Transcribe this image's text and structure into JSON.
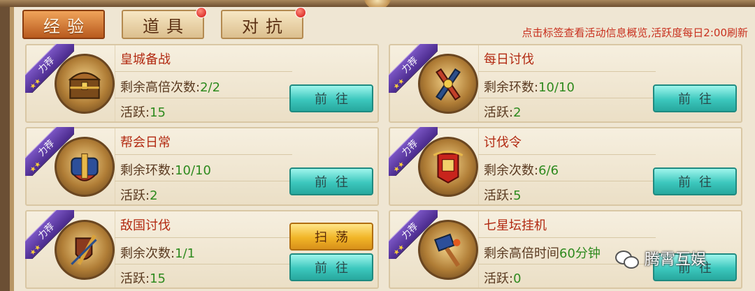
{
  "tabs": [
    {
      "label": "经验",
      "active": true,
      "badge": false
    },
    {
      "label": "道具",
      "active": false,
      "badge": true
    },
    {
      "label": "对抗",
      "active": false,
      "badge": true
    }
  ],
  "hint": "点击标签查看活动信息概览,活跃度每日2:00刷新",
  "ribbon_label": "力荐",
  "activities": [
    {
      "title": "皇城备战",
      "line1_label": "剩余高倍次数:",
      "line1_value": "2/2",
      "line2_label": "活跃:",
      "line2_value": "15",
      "buttons": [
        "前往"
      ],
      "icon": "treasure-chest-icon"
    },
    {
      "title": "每日讨伐",
      "line1_label": "剩余环数:",
      "line1_value": "10/10",
      "line2_label": "活跃:",
      "line2_value": "2",
      "buttons": [
        "前往"
      ],
      "icon": "crossed-blades-icon"
    },
    {
      "title": "帮会日常",
      "line1_label": "剩余环数:",
      "line1_value": "10/10",
      "line2_label": "活跃:",
      "line2_value": "2",
      "buttons": [
        "前往"
      ],
      "icon": "scroll-bundle-icon"
    },
    {
      "title": "讨伐令",
      "line1_label": "剩余次数:",
      "line1_value": "6/6",
      "line2_label": "活跃:",
      "line2_value": "5",
      "buttons": [
        "前往"
      ],
      "icon": "red-token-icon"
    },
    {
      "title": "敌国讨伐",
      "line1_label": "剩余次数:",
      "line1_value": "1/1",
      "line2_label": "活跃:",
      "line2_value": "15",
      "buttons": [
        "扫荡",
        "前往"
      ],
      "icon": "sword-shield-icon"
    },
    {
      "title": "七星坛挂机",
      "line1_label": "剩余高倍时间",
      "line1_value": "60分钟",
      "line2_label": "活跃:",
      "line2_value": "0",
      "buttons": [
        "前往"
      ],
      "icon": "hammer-icon"
    }
  ],
  "watermark": "腾霄互娱",
  "colors": {
    "title_red": "#b22a12",
    "value_green": "#2e8a1e",
    "button_teal": "#3cc7bd",
    "button_gold": "#f1b527",
    "ribbon_purple": "#5a35a4"
  }
}
